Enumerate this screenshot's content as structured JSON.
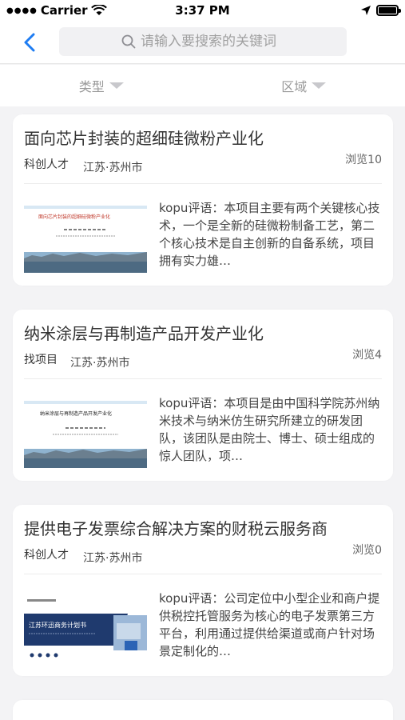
{
  "status_bar": {
    "carrier": "Carrier",
    "time": "3:37 PM"
  },
  "nav": {
    "search_placeholder": "请输入要搜索的关键词"
  },
  "filters": [
    {
      "label": "类型"
    },
    {
      "label": "区域"
    }
  ],
  "items": [
    {
      "title": "面向芯片封装的超细硅微粉产业化",
      "tag": "科创人才",
      "location": "江苏·苏州市",
      "views": "浏览10",
      "description": "kopu评语：本项目主要有两个关键核心技术，一个是全新的硅微粉制备工艺，第二个核心技术是自主创新的自备系统，项目拥有实力雄…",
      "thumb_title": "面向芯片封装的超细硅微粉产业化"
    },
    {
      "title": "纳米涂层与再制造产品开发产业化",
      "tag": "找项目",
      "location": "江苏·苏州市",
      "views": "浏览4",
      "description": "kopu评语：本项目是由中国科学院苏州纳米技术与纳米仿生研究所建立的研发团队，该团队是由院士、博士、硕士组成的惊人团队，项…",
      "thumb_title": "纳米涂层与再制造产品开发产业化"
    },
    {
      "title": "提供电子发票综合解决方案的财税云服务商",
      "tag": "科创人才",
      "location": "江苏·苏州市",
      "views": "浏览0",
      "description": "kopu评语：公司定位中小型企业和商户提供税控托管服务为核心的电子发票第三方平台，利用通过提供给渠道或商户针对场景定制化的…",
      "thumb_title": "江苏环迅商务计划书"
    }
  ],
  "colors": {
    "accent": "#1e7cf2",
    "background": "#f3f3f5"
  }
}
